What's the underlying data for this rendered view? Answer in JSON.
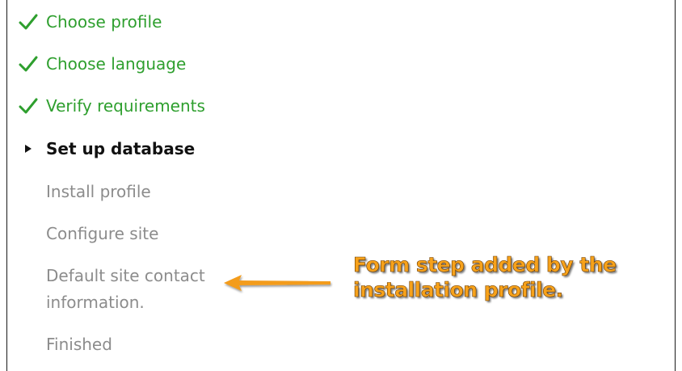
{
  "steps": [
    {
      "label": "Choose profile",
      "state": "done",
      "icon": "checkmark-icon"
    },
    {
      "label": "Choose language",
      "state": "done",
      "icon": "checkmark-icon"
    },
    {
      "label": "Verify requirements",
      "state": "done",
      "icon": "checkmark-icon"
    },
    {
      "label": "Set up database",
      "state": "active",
      "icon": "triangle-right-icon"
    },
    {
      "label": "Install profile",
      "state": "pending"
    },
    {
      "label": "Configure site",
      "state": "pending"
    },
    {
      "label_line1": "Default site contact",
      "label_line2": "information.",
      "state": "pending"
    },
    {
      "label": "Finished",
      "state": "pending"
    }
  ],
  "annotation": {
    "line1": "Form step added by the",
    "line2": "installation profile.",
    "icon": "arrow-left-icon"
  },
  "colors": {
    "done": "#2e9f2e",
    "active": "#111111",
    "pending": "#8c8c8c",
    "annotation": "#f7a21b"
  }
}
